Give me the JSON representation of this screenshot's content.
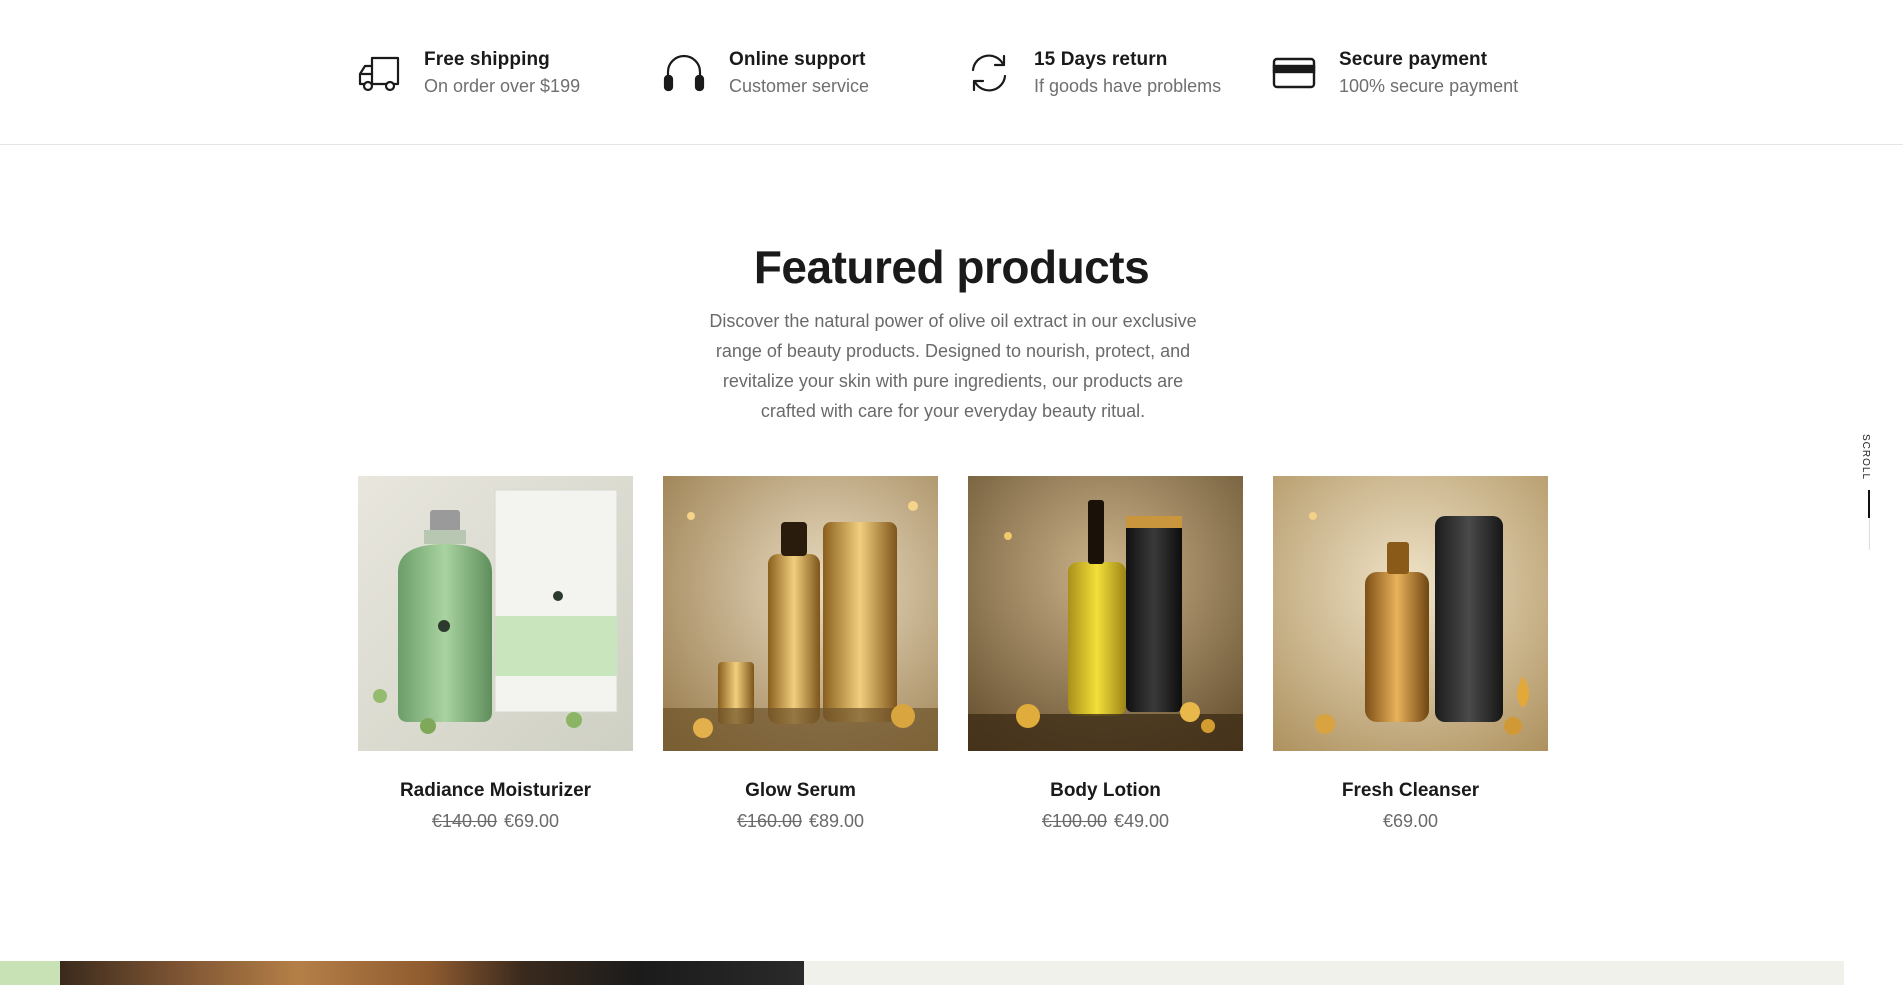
{
  "features": [
    {
      "icon": "truck-icon",
      "title": "Free shipping",
      "subtitle": "On order over $199"
    },
    {
      "icon": "headphones-icon",
      "title": "Online support",
      "subtitle": "Customer service"
    },
    {
      "icon": "refresh-icon",
      "title": "15 Days return",
      "subtitle": "If goods have problems"
    },
    {
      "icon": "credit-card-icon",
      "title": "Secure payment",
      "subtitle": "100% secure payment"
    }
  ],
  "featured": {
    "heading": "Featured products",
    "description": "Discover the natural power of olive oil extract in our exclusive range of beauty products. Designed to nourish, protect, and revitalize your skin with pure ingredients, our products are crafted with care for your everyday beauty ritual.",
    "products": [
      {
        "name": "Radiance Moisturizer",
        "old_price": "€140.00",
        "price": "€69.00"
      },
      {
        "name": "Glow Serum",
        "old_price": "€160.00",
        "price": "€89.00"
      },
      {
        "name": "Body Lotion",
        "old_price": "€100.00",
        "price": "€49.00"
      },
      {
        "name": "Fresh Cleanser",
        "old_price": "",
        "price": "€69.00"
      }
    ]
  },
  "scroll_label": "SCROLL",
  "colors": {
    "text": "#1a1a1a",
    "muted": "#6a6a6a",
    "divider": "#e5e5e5"
  }
}
